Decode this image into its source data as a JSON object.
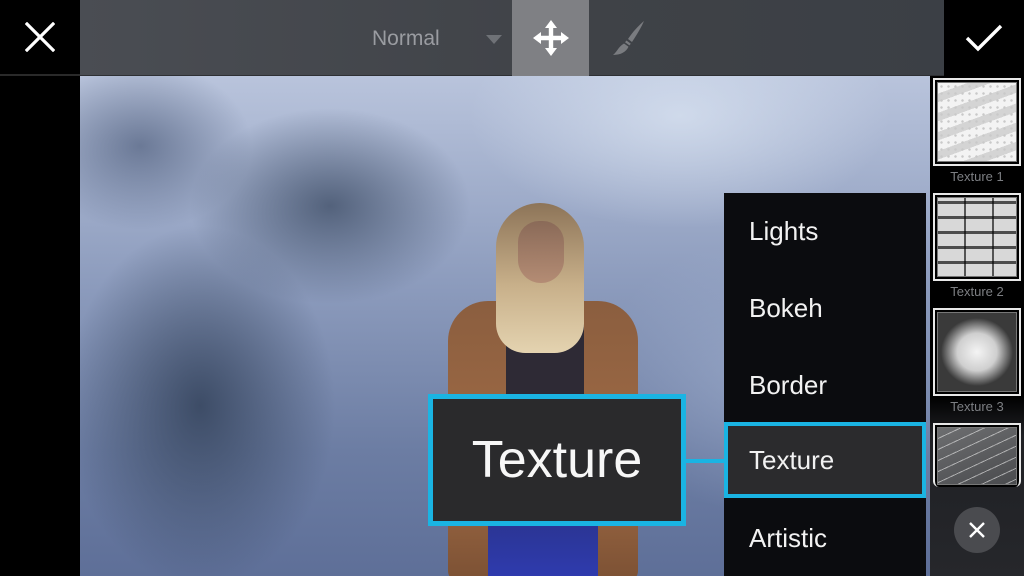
{
  "topbar": {
    "close_icon": "close-icon",
    "blend_mode": {
      "selected": "Normal",
      "caret_icon": "caret-down-icon"
    },
    "tools": [
      {
        "name": "move",
        "icon": "move-arrows-icon",
        "active": true
      },
      {
        "name": "brush",
        "icon": "paintbrush-icon",
        "active": false
      }
    ],
    "apply_icon": "checkmark-icon"
  },
  "category_menu": {
    "items": [
      {
        "label": "Lights",
        "selected": false
      },
      {
        "label": "Bokeh",
        "selected": false
      },
      {
        "label": "Border",
        "selected": false
      },
      {
        "label": "Texture",
        "selected": true
      },
      {
        "label": "Artistic",
        "selected": false
      }
    ]
  },
  "callout": {
    "label": "Texture",
    "accent": "#1ab4e3"
  },
  "texture_strip": {
    "items": [
      {
        "label": "Texture 1"
      },
      {
        "label": "Texture 2"
      },
      {
        "label": "Texture 3"
      },
      {
        "label": ""
      }
    ],
    "close_icon": "close-icon"
  },
  "colors": {
    "accent": "#1ab4e3",
    "toolbar_bg": "#44474d",
    "menu_bg": "#0b0c0f",
    "selected_item_bg": "#2b2b2d"
  }
}
